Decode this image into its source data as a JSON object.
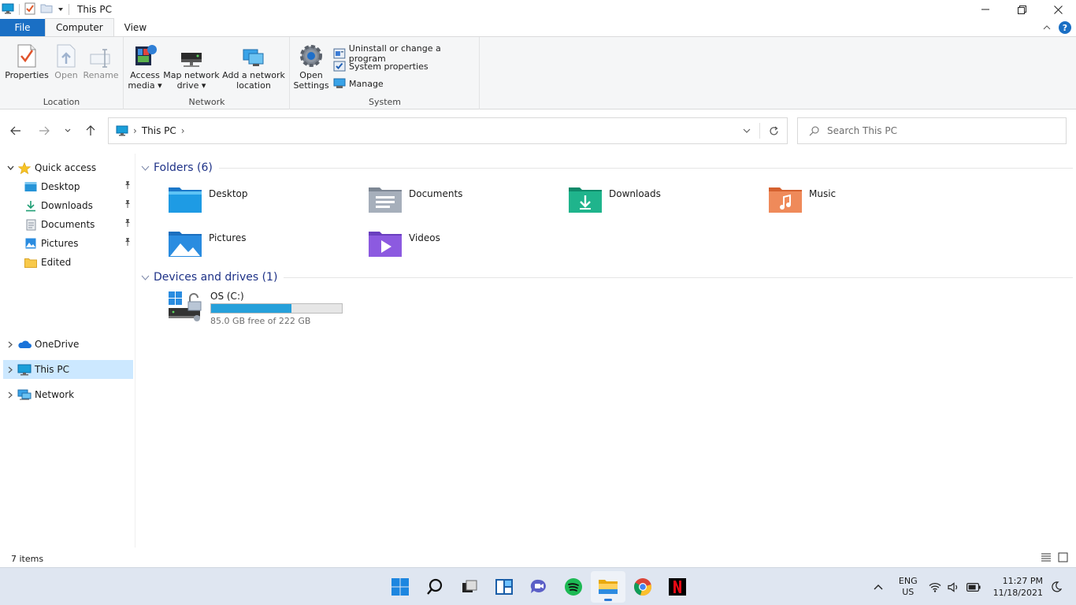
{
  "window": {
    "title": "This PC",
    "controls": {
      "minimize": "minimize",
      "maximize": "restore",
      "close": "close"
    }
  },
  "ribbon": {
    "tabs": [
      {
        "label": "File"
      },
      {
        "label": "Computer"
      },
      {
        "label": "View"
      }
    ],
    "active_tab": "Computer",
    "groups": {
      "location": {
        "label": "Location",
        "properties": "Properties",
        "open": "Open",
        "rename": "Rename"
      },
      "network": {
        "label": "Network",
        "access_media_l1": "Access",
        "access_media_l2": "media",
        "map_drive_l1": "Map network",
        "map_drive_l2": "drive",
        "add_location_l1": "Add a network",
        "add_location_l2": "location"
      },
      "system": {
        "label": "System",
        "open_settings_l1": "Open",
        "open_settings_l2": "Settings",
        "uninstall": "Uninstall or change a program",
        "system_properties": "System properties",
        "manage": "Manage"
      }
    }
  },
  "address": {
    "crumb": "This PC",
    "search_placeholder": "Search This PC"
  },
  "navpane": {
    "quick_access": "Quick access",
    "quick_items": [
      {
        "label": "Desktop",
        "pinned": true
      },
      {
        "label": "Downloads",
        "pinned": true
      },
      {
        "label": "Documents",
        "pinned": true
      },
      {
        "label": "Pictures",
        "pinned": true
      },
      {
        "label": "Edited",
        "pinned": false
      }
    ],
    "onedrive": "OneDrive",
    "this_pc": "This PC",
    "network": "Network"
  },
  "content": {
    "folders_header": "Folders (6)",
    "folders": [
      {
        "label": "Desktop"
      },
      {
        "label": "Documents"
      },
      {
        "label": "Downloads"
      },
      {
        "label": "Music"
      },
      {
        "label": "Pictures"
      },
      {
        "label": "Videos"
      }
    ],
    "devices_header": "Devices and drives (1)",
    "drive": {
      "name": "OS (C:)",
      "free_text": "85.0 GB free of 222 GB",
      "used_fraction": 0.617
    }
  },
  "status": {
    "items": "7 items"
  },
  "taskbar": {
    "lang": "ENG",
    "region": "US",
    "time": "11:27 PM",
    "date": "11/18/2021"
  },
  "colors": {
    "accent": "#1a6fc4",
    "selection": "#cce8ff",
    "drive_fill": "#26a0da",
    "section_header": "#1e3287"
  }
}
